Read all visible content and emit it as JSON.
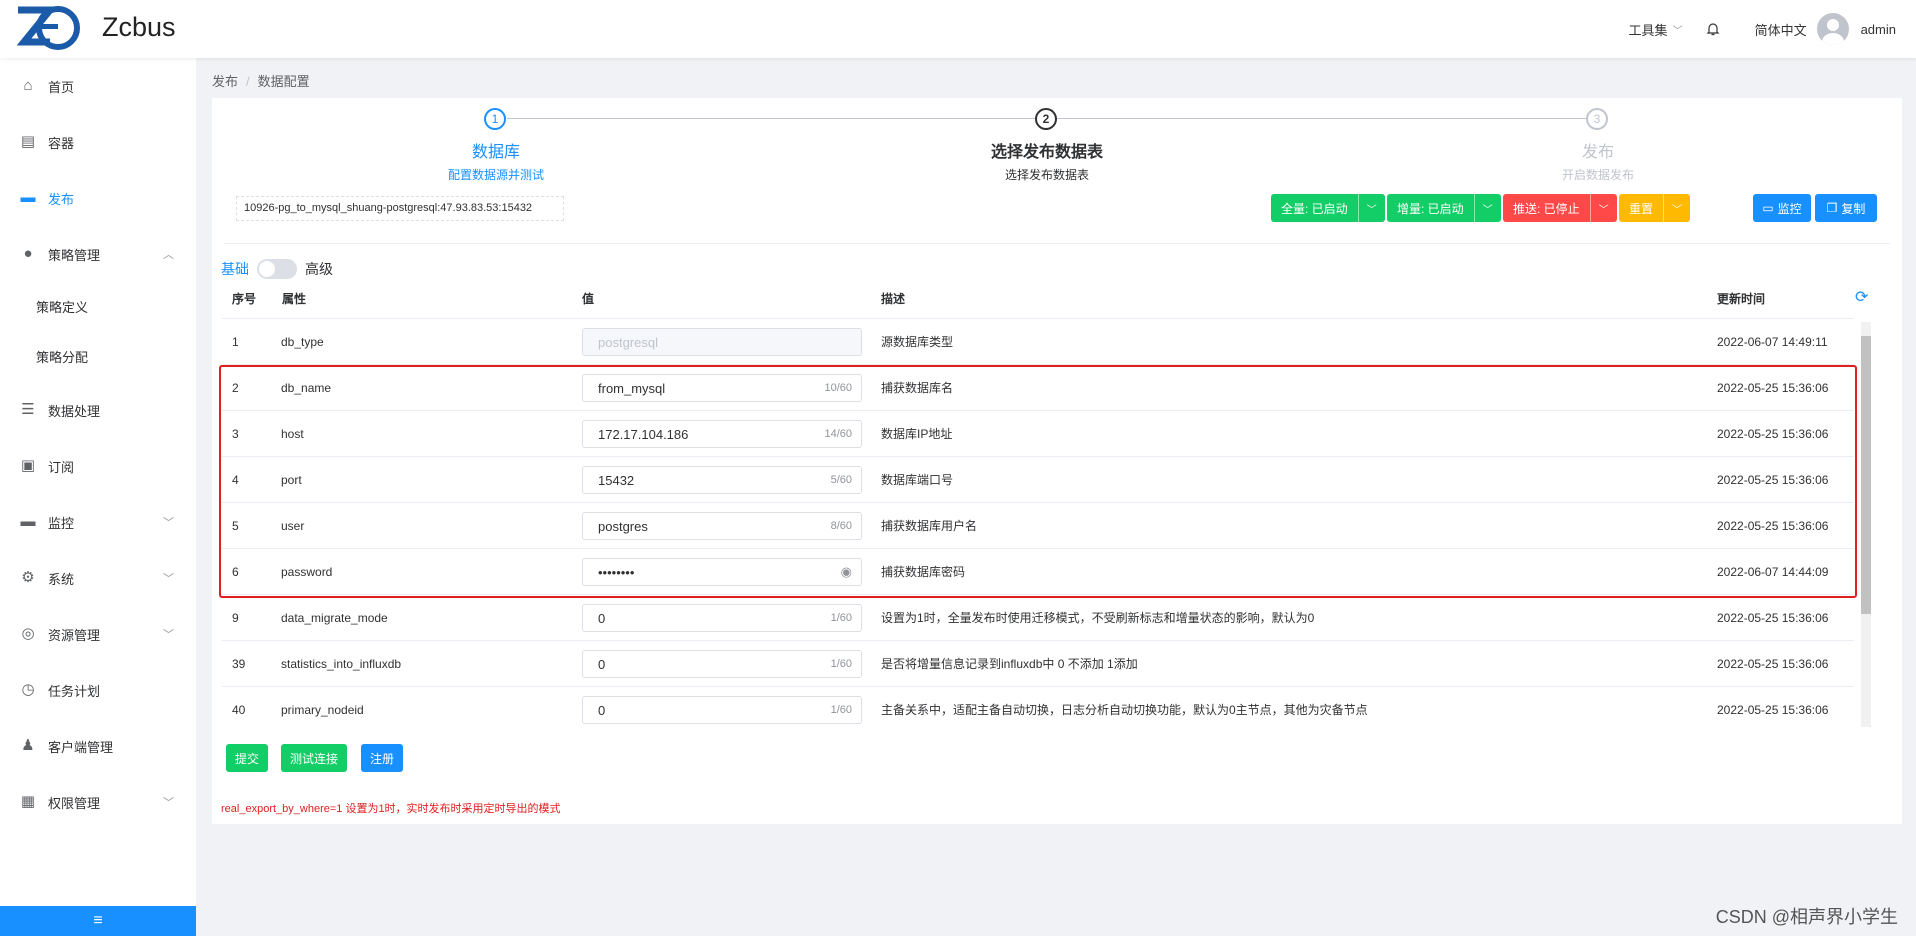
{
  "header": {
    "app_name": "Zcbus",
    "tools_label": "工具集",
    "language": "简体中文",
    "username": "admin"
  },
  "sidebar": {
    "items": [
      {
        "label": "首页",
        "icon": "home-icon"
      },
      {
        "label": "容器",
        "icon": "clipboard-icon"
      },
      {
        "label": "发布",
        "icon": "monitor-icon"
      },
      {
        "label": "策略管理",
        "icon": "bulb-icon"
      },
      {
        "label": "策略定义"
      },
      {
        "label": "策略分配"
      },
      {
        "label": "数据处理",
        "icon": "sliders-icon"
      },
      {
        "label": "订阅",
        "icon": "clipboard-check-icon"
      },
      {
        "label": "监控",
        "icon": "monitor-icon"
      },
      {
        "label": "系统",
        "icon": "gear-icon"
      },
      {
        "label": "资源管理",
        "icon": "chip-icon"
      },
      {
        "label": "任务计划",
        "icon": "clock-icon"
      },
      {
        "label": "客户端管理",
        "icon": "user-icon"
      },
      {
        "label": "权限管理",
        "icon": "grid-icon"
      }
    ],
    "collapse_label": "≡"
  },
  "breadcrumb": {
    "parent": "发布",
    "current": "数据配置"
  },
  "steps": [
    {
      "num": "1",
      "title": "数据库",
      "desc": "配置数据源并测试",
      "color": "#1890ff"
    },
    {
      "num": "2",
      "title": "选择发布数据表",
      "desc": "选择发布数据表",
      "color": "#303133"
    },
    {
      "num": "3",
      "title": "发布",
      "desc": "开启数据发布",
      "color": "#c0c4cc"
    }
  ],
  "connection": "10926-pg_to_mysql_shuang-postgresql:47.93.83.53:15432",
  "actions": {
    "full": "全量: 已启动",
    "incremental": "增量: 已启动",
    "push": "推送: 已停止",
    "reset": "重置",
    "monitor": "监控",
    "copy": "复制"
  },
  "mode": {
    "basic": "基础",
    "advanced": "高级"
  },
  "table": {
    "headers": [
      "序号",
      "属性",
      "值",
      "描述",
      "更新时间"
    ],
    "rows": [
      {
        "id": "1",
        "attr": "db_type",
        "value": "postgresql",
        "count": "",
        "desc": "源数据库类型",
        "time": "2022-06-07 14:49:11"
      },
      {
        "id": "2",
        "attr": "db_name",
        "value": "from_mysql",
        "count": "10/60",
        "desc": "捕获数据库名",
        "time": "2022-05-25 15:36:06"
      },
      {
        "id": "3",
        "attr": "host",
        "value": "172.17.104.186",
        "count": "14/60",
        "desc": "数据库IP地址",
        "time": "2022-05-25 15:36:06"
      },
      {
        "id": "4",
        "attr": "port",
        "value": "15432",
        "count": "5/60",
        "desc": "数据库端口号",
        "time": "2022-05-25 15:36:06"
      },
      {
        "id": "5",
        "attr": "user",
        "value": "postgres",
        "count": "8/60",
        "desc": "捕获数据库用户名",
        "time": "2022-05-25 15:36:06"
      },
      {
        "id": "6",
        "attr": "password",
        "value": "••••••••",
        "count": "",
        "desc": "捕获数据库密码",
        "time": "2022-06-07 14:44:09"
      },
      {
        "id": "9",
        "attr": "data_migrate_mode",
        "value": "0",
        "count": "1/60",
        "desc": "设置为1时，全量发布时使用迁移模式，不受刷新标志和增量状态的影响，默认为0",
        "time": "2022-05-25 15:36:06"
      },
      {
        "id": "39",
        "attr": "statistics_into_influxdb",
        "value": "0",
        "count": "1/60",
        "desc": "是否将增量信息记录到influxdb中 0 不添加 1添加",
        "time": "2022-05-25 15:36:06"
      },
      {
        "id": "40",
        "attr": "primary_nodeid",
        "value": "0",
        "count": "1/60",
        "desc": "主备关系中，适配主备自动切换，日志分析自动切换功能，默认为0主节点，其他为灾备节点",
        "time": "2022-05-25 15:36:06"
      }
    ]
  },
  "buttons": {
    "submit": "提交",
    "test": "测试连接",
    "register": "注册"
  },
  "note": "real_export_by_where=1 设置为1时，实时发布时采用定时导出的模式",
  "watermark": "CSDN @相声界小学生",
  "colors": {
    "primary": "#1890ff",
    "success": "#13ce66",
    "danger": "#ff4949",
    "warning": "#ffba00",
    "highlight": "#e02020"
  }
}
